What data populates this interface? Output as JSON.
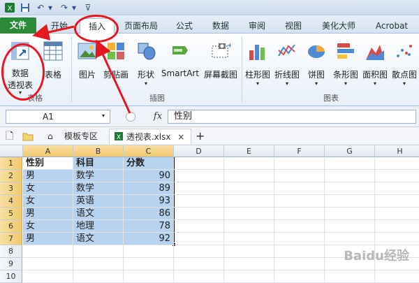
{
  "qat": {
    "save_icon": "save-icon",
    "undo_icon": "undo-icon",
    "redo_icon": "redo-icon"
  },
  "tabs": {
    "file": "文件",
    "home": "开始",
    "insert": "插入",
    "layout": "页面布局",
    "formulas": "公式",
    "data": "数据",
    "review": "审阅",
    "view": "视图",
    "meihua": "美化大师",
    "acrobat": "Acrobat"
  },
  "ribbon": {
    "pivot_line1": "数据",
    "pivot_line2": "透视表",
    "table": "表格",
    "picture": "图片",
    "clipart": "剪贴画",
    "shapes": "形状",
    "smartart": "SmartArt",
    "screenshot": "屏幕截图",
    "column_chart": "柱形图",
    "line_chart": "折线图",
    "pie_chart": "饼图",
    "bar_chart": "条形图",
    "area_chart": "面积图",
    "scatter_chart": "散点图",
    "group_tables": "表格",
    "group_illustrations": "插图",
    "group_charts": "图表"
  },
  "formula_bar": {
    "name_box": "A1",
    "fx": "fx",
    "value": "性别"
  },
  "doc_tabs": {
    "template": "模板专区",
    "file": "透视表.xlsx",
    "close": "×",
    "new": "+"
  },
  "columns": [
    "A",
    "B",
    "C",
    "D",
    "E",
    "F",
    "G",
    "H"
  ],
  "rows": [
    "1",
    "2",
    "3",
    "4",
    "5",
    "6",
    "7",
    "8",
    "9",
    "10"
  ],
  "table": {
    "header": [
      "性别",
      "科目",
      "分数"
    ],
    "data": [
      [
        "男",
        "数学",
        "90"
      ],
      [
        "女",
        "数学",
        "89"
      ],
      [
        "女",
        "英语",
        "93"
      ],
      [
        "男",
        "语文",
        "86"
      ],
      [
        "女",
        "地理",
        "78"
      ],
      [
        "男",
        "语文",
        "92"
      ]
    ]
  },
  "watermark": "Baidu经验",
  "colors": {
    "file_tab": "#2a8a3a",
    "selection": "#b8d3ef",
    "annotation": "#e8161f"
  }
}
